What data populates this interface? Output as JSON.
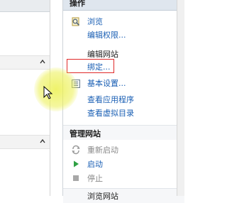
{
  "actions_pane": {
    "title": "操作",
    "browse": {
      "label": "浏览",
      "icon": "browse-icon"
    },
    "edit_permissions": {
      "label": "编辑权限..."
    },
    "edit_site": {
      "title": "编辑网站",
      "bindings": "绑定...",
      "basic_settings": {
        "label": "基本设置...",
        "icon": "settings-page-icon"
      },
      "view_applications": "查看应用程序",
      "view_virtual_directories": "查看虚拟目录"
    },
    "manage_site": {
      "title": "管理网站",
      "restart": {
        "label": "重新启动",
        "icon": "restart-icon"
      },
      "start": {
        "label": "启动",
        "icon": "start-icon"
      },
      "stop": {
        "label": "停止",
        "icon": "stop-icon"
      }
    },
    "browse_site": {
      "title": "浏览网站"
    }
  },
  "colors": {
    "link": "#1a5fb4",
    "disabled": "#8a8a8a",
    "highlight": "#e02a2a",
    "cursor_glow": "#ecf050",
    "start_green": "#2ea043"
  }
}
